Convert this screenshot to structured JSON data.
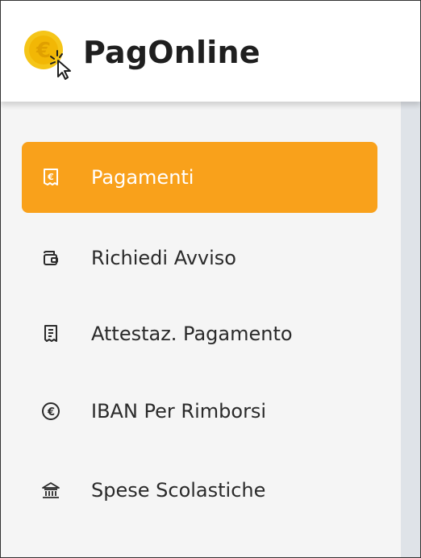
{
  "app": {
    "title": "PagOnline",
    "logo_icon": "euro-coin-cursor-icon",
    "colors": {
      "accent": "#f9a11b",
      "logo_coin": "#f5c518",
      "sidebar_bg": "#f5f5f5",
      "text": "#2a2a2a"
    }
  },
  "sidebar": {
    "items": [
      {
        "label": "Pagamenti",
        "icon": "euro-receipt-icon",
        "active": true
      },
      {
        "label": "Richiedi Avviso",
        "icon": "wallet-icon",
        "active": false
      },
      {
        "label": "Attestaz. Pagamento",
        "icon": "receipt-icon",
        "active": false
      },
      {
        "label": "IBAN Per Rimborsi",
        "icon": "euro-circle-icon",
        "active": false
      },
      {
        "label": "Spese Scolastiche",
        "icon": "bank-building-icon",
        "active": false
      }
    ]
  }
}
